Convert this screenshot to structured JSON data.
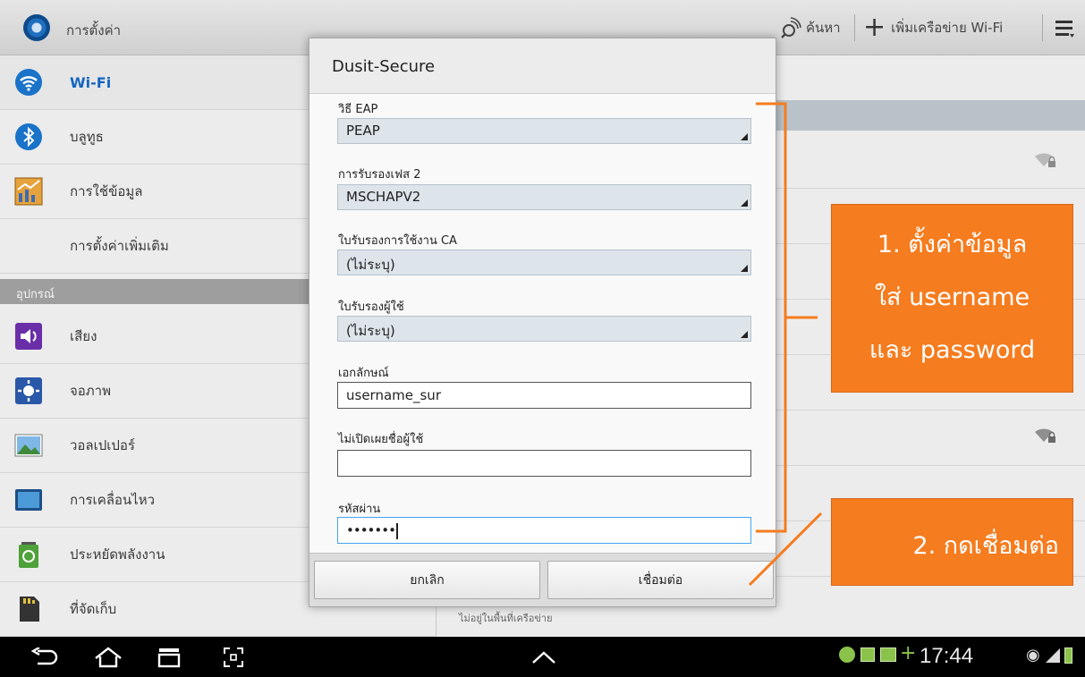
{
  "action_bar": {
    "title": "การตั้งค่า",
    "search_label": "ค้นหา",
    "add_network_label": "เพิ่มเครือข่าย Wi-Fi"
  },
  "sidebar": {
    "items": [
      {
        "label": "Wi-Fi",
        "icon": "wifi-icon",
        "selected": true
      },
      {
        "label": "บลูทูธ",
        "icon": "bluetooth-icon"
      },
      {
        "label": "การใช้ข้อมูล",
        "icon": "data-usage-icon"
      },
      {
        "label": "การตั้งค่าเพิ่มเติม",
        "icon": ""
      }
    ],
    "section_header": "อุปกรณ์",
    "device_items": [
      {
        "label": "เสียง",
        "icon": "sound-icon"
      },
      {
        "label": "จอภาพ",
        "icon": "display-icon"
      },
      {
        "label": "วอลเปเปอร์",
        "icon": "wallpaper-icon"
      },
      {
        "label": "การเคลื่อนไหว",
        "icon": "motion-icon"
      },
      {
        "label": "ประหยัดพลังงาน",
        "icon": "power-saving-icon"
      },
      {
        "label": "ที่จัดเก็บ",
        "icon": "storage-icon"
      }
    ]
  },
  "right_pane": {
    "out_of_range_text": "ไม่อยู่ในพื้นที่เครือข่าย"
  },
  "dialog": {
    "title": "Dusit-Secure",
    "eap_method_label": "วิธี EAP",
    "eap_method_value": "PEAP",
    "phase2_label": "การรับรองเฟส 2",
    "phase2_value": "MSCHAPV2",
    "ca_cert_label": "ใบรับรองการใช้งาน CA",
    "ca_cert_value": "(ไม่ระบุ)",
    "user_cert_label": "ใบรับรองผู้ใช้",
    "user_cert_value": "(ไม่ระบุ)",
    "identity_label": "เอกลักษณ์",
    "identity_value": "username_sur",
    "anon_identity_label": "ไม่เปิดเผยชื่อผู้ใช้",
    "anon_identity_value": "",
    "password_label": "รหัสผ่าน",
    "password_value": "•••••••",
    "cancel_label": "ยกเลิก",
    "connect_label": "เชื่อมต่อ"
  },
  "annotations": {
    "callout1_line1": "1. ตั้งค่าข้อมูล",
    "callout1_line2": "ใส่ username",
    "callout1_line3": "และ password",
    "callout2": "2. กดเชื่อมต่อ",
    "color": "#f57c1f"
  },
  "status_bar": {
    "clock": "17:44"
  }
}
